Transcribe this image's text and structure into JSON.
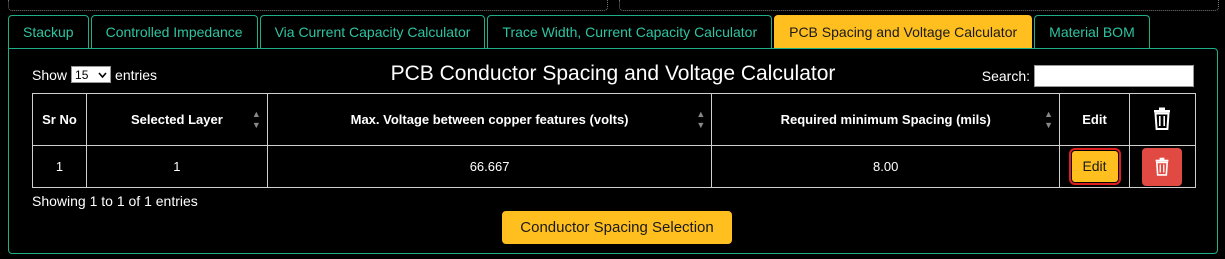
{
  "tabs": [
    {
      "label": "Stackup",
      "active": false
    },
    {
      "label": "Controlled Impedance",
      "active": false
    },
    {
      "label": "Via Current Capacity Calculator",
      "active": false
    },
    {
      "label": "Trace Width, Current Capacity Calculator",
      "active": false
    },
    {
      "label": "PCB Spacing and Voltage Calculator",
      "active": true
    },
    {
      "label": "Material BOM",
      "active": false
    }
  ],
  "controls": {
    "show_label": "Show",
    "entries_value": "15",
    "entries_label": "entries",
    "search_label": "Search:",
    "search_value": ""
  },
  "panel_title": "PCB Conductor Spacing and Voltage Calculator",
  "table": {
    "headers": {
      "sr_no": "Sr No",
      "layer": "Selected Layer",
      "voltage": "Max. Voltage between copper features (volts)",
      "spacing": "Required minimum Spacing (mils)",
      "edit": "Edit"
    },
    "rows": [
      {
        "sr_no": "1",
        "layer": "1",
        "voltage": "66.667",
        "spacing": "8.00",
        "edit_label": "Edit"
      }
    ]
  },
  "footer": {
    "showing_text": "Showing 1 to 1 of 1 entries",
    "action_button": "Conductor Spacing Selection"
  },
  "colors": {
    "accent": "#ffbf1f",
    "tab_border": "#1fae88",
    "tab_text": "#2ec4a0",
    "delete": "#e04a43",
    "highlight": "#e02020"
  }
}
